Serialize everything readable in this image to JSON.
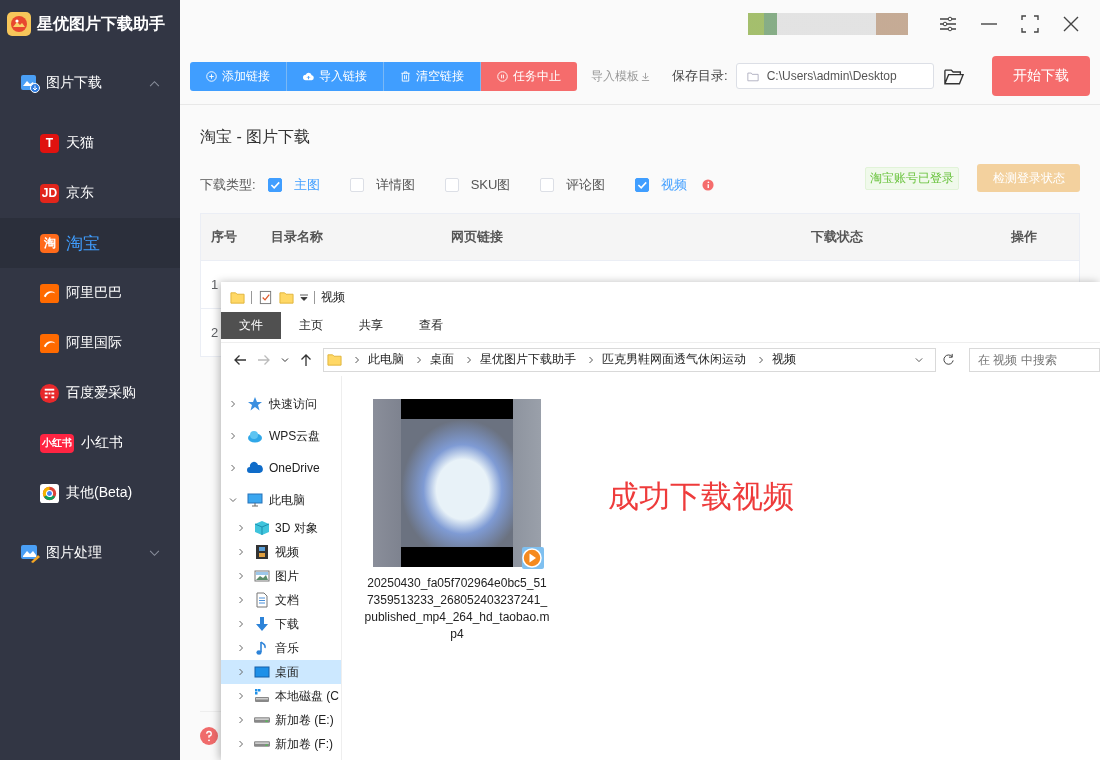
{
  "app": {
    "title": "星优图片下载助手"
  },
  "sidebar": {
    "groups": [
      {
        "label": "图片下载",
        "kind": "download",
        "expanded": true,
        "items": [
          {
            "label": "天猫",
            "kind": "badge",
            "badge": "T",
            "color": "#e0120f",
            "selected": false
          },
          {
            "label": "京东",
            "kind": "badge",
            "badge": "JD",
            "color": "#e1251b",
            "selected": false
          },
          {
            "label": "淘宝",
            "kind": "badge",
            "badge": "淘",
            "color": "#ff6a1a",
            "selected": true
          },
          {
            "label": "阿里巴巴",
            "kind": "alibaba",
            "color": "#ff6a00",
            "selected": false
          },
          {
            "label": "阿里国际",
            "kind": "alibaba",
            "color": "#ff6a00",
            "selected": false
          },
          {
            "label": "百度爱采购",
            "kind": "baidu",
            "color": "#e8282b",
            "selected": false
          },
          {
            "label": "小红书",
            "kind": "badge",
            "badge": "小红书",
            "color": "#ff2442",
            "selected": false
          },
          {
            "label": "其他(Beta)",
            "kind": "chrome",
            "color": "#ffffff",
            "selected": false
          }
        ]
      },
      {
        "label": "图片处理",
        "kind": "edit",
        "expanded": false
      }
    ]
  },
  "toolbar": {
    "buttons": [
      {
        "label": "添加链接",
        "kind": "primary"
      },
      {
        "label": "导入链接",
        "kind": "primary"
      },
      {
        "label": "清空链接",
        "kind": "primary"
      },
      {
        "label": "任务中止",
        "kind": "danger"
      }
    ],
    "template_link": "导入模板",
    "save_dir": {
      "label": "保存目录:",
      "value": "C:\\Users\\admin\\Desktop"
    },
    "start_button": "开始下载"
  },
  "page": {
    "title": "淘宝 - 图片下载",
    "type_label": "下载类型:",
    "types": [
      {
        "label": "主图",
        "checked": true
      },
      {
        "label": "详情图",
        "checked": false
      },
      {
        "label": "SKU图",
        "checked": false
      },
      {
        "label": "评论图",
        "checked": false
      },
      {
        "label": "视频",
        "checked": true
      }
    ],
    "login_status": "淘宝账号已登录",
    "check_login_button": {
      "label": "检测登录状态",
      "disabled": true
    }
  },
  "table": {
    "columns": [
      "序号",
      "目录名称",
      "网页链接",
      "下载状态",
      "操作"
    ],
    "rows": [
      {
        "index": "1"
      },
      {
        "index": "2"
      }
    ]
  },
  "explorer": {
    "title": "视频",
    "ribbon_tabs": [
      {
        "label": "文件",
        "selected": true
      },
      {
        "label": "主页",
        "selected": false
      },
      {
        "label": "共享",
        "selected": false
      },
      {
        "label": "查看",
        "selected": false
      }
    ],
    "breadcrumb": [
      "此电脑",
      "桌面",
      "星优图片下载助手",
      "匹克男鞋网面透气休闲运动",
      "视频"
    ],
    "search": {
      "placeholder": "在 视频 中搜索"
    },
    "nav": [
      {
        "label": "快速访问",
        "kind": "star",
        "expanded": false,
        "selected": false
      },
      {
        "label": "WPS云盘",
        "kind": "wps",
        "expanded": false,
        "selected": false
      },
      {
        "label": "OneDrive",
        "kind": "cloud",
        "expanded": false,
        "selected": false
      },
      {
        "label": "此电脑",
        "kind": "pc",
        "expanded": true,
        "selected": false,
        "children": [
          {
            "label": "3D 对象",
            "kind": "cube",
            "expanded": false,
            "selected": false
          },
          {
            "label": "视频",
            "kind": "film",
            "expanded": false,
            "selected": false
          },
          {
            "label": "图片",
            "kind": "picture",
            "expanded": false,
            "selected": false
          },
          {
            "label": "文档",
            "kind": "doc",
            "expanded": false,
            "selected": false
          },
          {
            "label": "下载",
            "kind": "download",
            "expanded": false,
            "selected": false
          },
          {
            "label": "音乐",
            "kind": "music",
            "expanded": false,
            "selected": false
          },
          {
            "label": "桌面",
            "kind": "desktop",
            "expanded": false,
            "selected": true
          },
          {
            "label": "本地磁盘 (C",
            "kind": "disk",
            "expanded": false,
            "selected": false
          },
          {
            "label": "新加卷 (E:)",
            "kind": "drive",
            "expanded": false,
            "selected": false
          },
          {
            "label": "新加卷 (F:)",
            "kind": "drive",
            "expanded": false,
            "selected": false
          }
        ]
      }
    ],
    "files": [
      {
        "name": "20250430_fa05f702964e0bc5_517359513233_268052403237241_published_mp4_264_hd_taobao.mp4",
        "kind": "video"
      }
    ],
    "annotation": "成功下载视频"
  }
}
